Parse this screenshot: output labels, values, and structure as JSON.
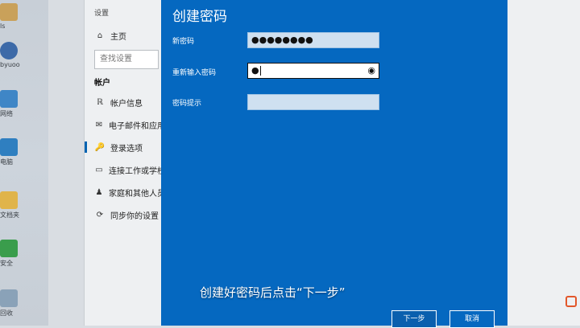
{
  "desktop": {
    "icons": [
      {
        "name": "desktop-icon-1",
        "caption": "ls",
        "color": "#c9a15a"
      },
      {
        "name": "user-icon",
        "caption": "byuoo",
        "color": "#3d6aa8"
      },
      {
        "name": "network-icon",
        "caption": "网络",
        "color": "#3f86c6"
      },
      {
        "name": "pc-icon",
        "caption": "电脑",
        "color": "#2f7fc0"
      },
      {
        "name": "folder-icon",
        "caption": "文档夹",
        "color": "#e0b44a"
      },
      {
        "name": "security-icon",
        "caption": "安全",
        "color": "#3a9d4c"
      },
      {
        "name": "recycle-icon",
        "caption": "回收",
        "color": "#8aa2b8"
      }
    ]
  },
  "settings": {
    "title": "设置",
    "home": "主页",
    "search_placeholder": "查找设置",
    "section": "帐户",
    "nav": [
      {
        "icon": "ℝ",
        "label": "帐户信息"
      },
      {
        "icon": "✉",
        "label": "电子邮件和应用"
      },
      {
        "icon": "🔑",
        "label": "登录选项",
        "active": true
      },
      {
        "icon": "▭",
        "label": "连接工作或学校"
      },
      {
        "icon": "♟",
        "label": "家庭和其他人员"
      },
      {
        "icon": "⟳",
        "label": "同步你的设置"
      }
    ]
  },
  "dialog": {
    "title": "创建密码",
    "fields": [
      {
        "label": "新密码",
        "value": "●●●●●●●●",
        "active": false
      },
      {
        "label": "重新输入密码",
        "value": "●",
        "active": true,
        "reveal_icon": "eye-icon"
      },
      {
        "label": "密码提示",
        "value": "",
        "active": false
      }
    ],
    "next_button": "下一步",
    "cancel_button": "取消",
    "accent": "#0568c0"
  },
  "caption": "创建好密码后点击“下一步”"
}
